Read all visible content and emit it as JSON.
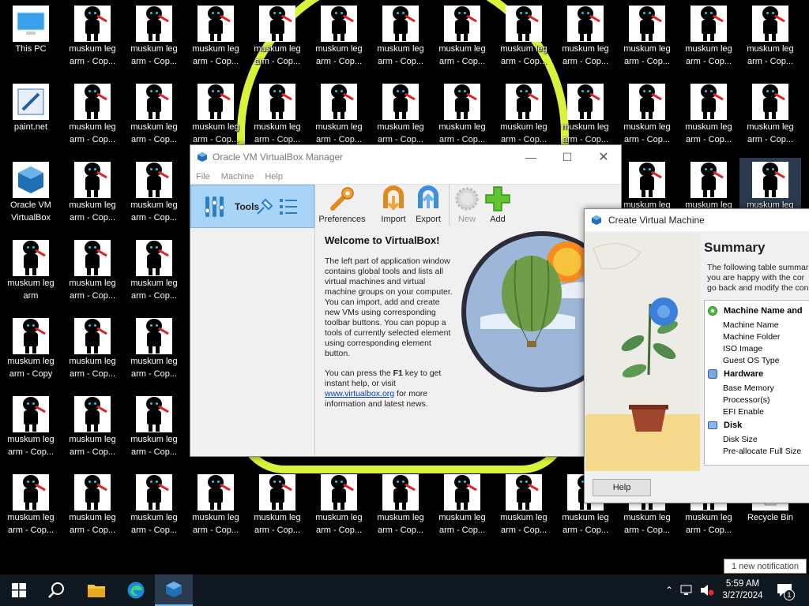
{
  "desktop": {
    "icons": {
      "this_pc": "This PC",
      "paint_net": "paint.net",
      "vbox": [
        "Oracle VM",
        "VirtualBox"
      ],
      "recycle_bin": "Recycle Bin",
      "copy_line1": "muskum leg",
      "copy_line2": "arm - Cop...",
      "copy_full": "arm - Copy",
      "arm": "arm"
    }
  },
  "vbox_manager": {
    "title": "Oracle VM VirtualBox Manager",
    "menu": [
      "File",
      "Machine",
      "Help"
    ],
    "tools_label": "Tools",
    "toolbar": [
      "Preferences",
      "Import",
      "Export",
      "New",
      "Add"
    ],
    "welcome_title": "Welcome to VirtualBox!",
    "welcome_p1": "The left part of application window contains global tools and lists all virtual machines and virtual machine groups on your computer. You can import, add and create new VMs using corresponding toolbar buttons. You can popup a tools of currently selected element using corresponding element button.",
    "welcome_p2_a": "You can press the ",
    "welcome_p2_key": "F1",
    "welcome_p2_b": " key to get instant help, or visit ",
    "welcome_link": "www.virtualbox.org",
    "welcome_p2_c": " for more information and latest news."
  },
  "create_vm": {
    "title": "Create Virtual Machine",
    "heading": "Summary",
    "intro_lines": [
      "The following table summar",
      "you are happy with the cor",
      "go back and modify the con"
    ],
    "sections": [
      {
        "title": "Machine Name and",
        "icon": "gear-icon",
        "rows": [
          "Machine Name",
          "Machine Folder",
          "ISO Image",
          "Guest OS Type"
        ]
      },
      {
        "title": "Hardware",
        "icon": "chip-icon",
        "rows": [
          "Base Memory",
          "Processor(s)",
          "EFI Enable"
        ]
      },
      {
        "title": "Disk",
        "icon": "disk-icon",
        "rows": [
          "Disk Size",
          "Pre-allocate Full Size"
        ]
      }
    ],
    "help_button": "Help"
  },
  "taskbar": {
    "time": "5:59 AM",
    "date": "3/27/2024",
    "notification": "1 new notification",
    "notif_count": "1"
  },
  "colors": {
    "accent_outline": "#d9f23b",
    "taskbar": "#101820",
    "tools_selected": "#a8d4f7",
    "link": "#0645ad"
  }
}
